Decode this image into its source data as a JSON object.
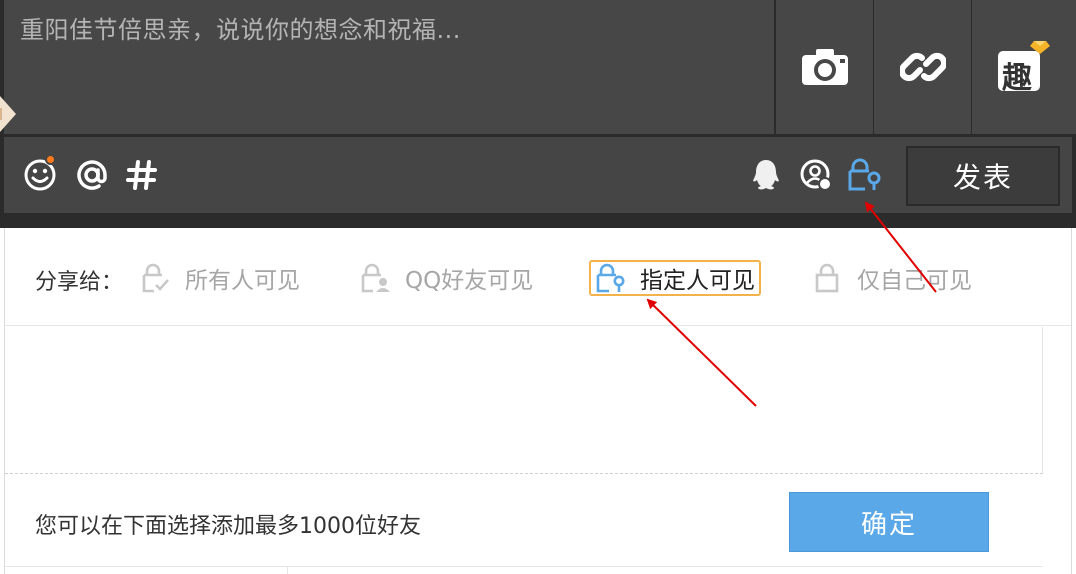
{
  "composer": {
    "placeholder": "重阳佳节倍思亲，说说你的想念和祝福...",
    "fun_label": "趣",
    "publish_label": "发表"
  },
  "share": {
    "label": "分享给：",
    "options": [
      {
        "label": "所有人可见",
        "selected": false
      },
      {
        "label": "QQ好友可见",
        "selected": false
      },
      {
        "label": "指定人可见",
        "selected": true
      },
      {
        "label": "仅自己可见",
        "selected": false
      }
    ]
  },
  "footer": {
    "hint": "您可以在下面选择添加最多1000位好友",
    "confirm_label": "确定"
  },
  "colors": {
    "dark_bg": "#2b2b2b",
    "toolbar_bg": "#454545",
    "accent_blue": "#5aa8e8",
    "selected_border": "#f4b24a",
    "notification": "#ff7a1a",
    "annotation_red": "#e00000"
  },
  "icons": [
    "camera-icon",
    "link-icon",
    "fun-icon",
    "emoji-icon",
    "at-icon",
    "hash-icon",
    "qq-icon",
    "friend-icon",
    "lock-person-icon",
    "everyone-lock-icon",
    "qq-friend-lock-icon",
    "specified-lock-icon",
    "self-lock-icon"
  ]
}
